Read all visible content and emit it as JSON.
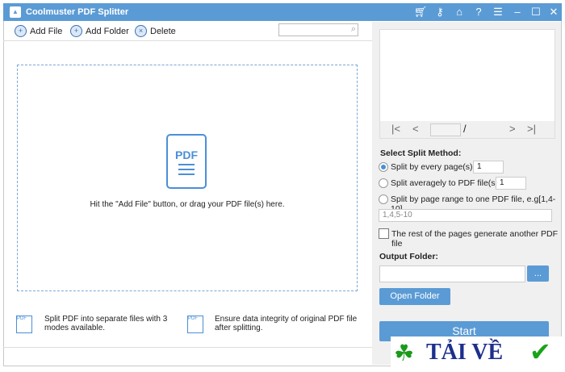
{
  "app": {
    "title": "Coolmuster PDF Splitter"
  },
  "toolbar": {
    "add_file": "Add File",
    "add_folder": "Add Folder",
    "delete": "Delete",
    "search_value": ""
  },
  "dropzone": {
    "icon_text": "PDF",
    "hint": "Hit the \"Add File\" button, or drag your PDF file(s) here."
  },
  "features": [
    {
      "text": "Split PDF into separate files with 3 modes available."
    },
    {
      "text": "Ensure data integrity of original PDF file after splitting."
    }
  ],
  "preview": {
    "page_value": "",
    "separator": "/"
  },
  "split": {
    "heading": "Select Split Method:",
    "option1": "Split by every page(s):",
    "option1_value": "1",
    "option2": "Split averagely to PDF file(s):",
    "option2_value": "1",
    "option3": "Split by page range to one PDF file, e.g[1,4-10]",
    "range_value": "1,4,5-10",
    "rest_checkbox": "The rest of the pages generate another PDF file",
    "selected": 1
  },
  "output": {
    "heading": "Output Folder:",
    "path": "",
    "browse": "...",
    "open_folder": "Open Folder"
  },
  "start": "Start",
  "watermark": "TẢI VỀ",
  "colors": {
    "accent": "#5b9bd5"
  }
}
